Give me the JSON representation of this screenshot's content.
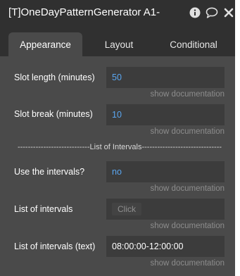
{
  "header": {
    "title": "[T]OneDayPatternGenerator A1-",
    "icons": [
      "info-icon",
      "comment-icon",
      "close-icon"
    ]
  },
  "tabs": [
    {
      "label": "Appearance",
      "active": true
    },
    {
      "label": "Layout",
      "active": false
    },
    {
      "label": "Conditional",
      "active": false
    }
  ],
  "fields": {
    "slot_length": {
      "label": "Slot length (minutes)",
      "value": "50",
      "doc": "show documentation"
    },
    "slot_break": {
      "label": "Slot break (minutes)",
      "value": "10",
      "doc": "show documentation"
    },
    "separator": "----------------------------List of Intervals-------------------------------",
    "use_intervals": {
      "label": "Use the intervals?",
      "value": "no",
      "doc": "show documentation"
    },
    "list_intervals": {
      "label": "List of intervals",
      "button": "Click",
      "doc": "show documentation"
    },
    "list_intervals_text": {
      "label": "List of intervals (text)",
      "value": "08:00:00-12:00:00",
      "doc": "show documentation"
    }
  },
  "colors": {
    "panel_bg": "#4a4a4a",
    "header_bg": "#303030",
    "field_bg": "#3c3c3c",
    "value_accent": "#5aa6f0"
  }
}
